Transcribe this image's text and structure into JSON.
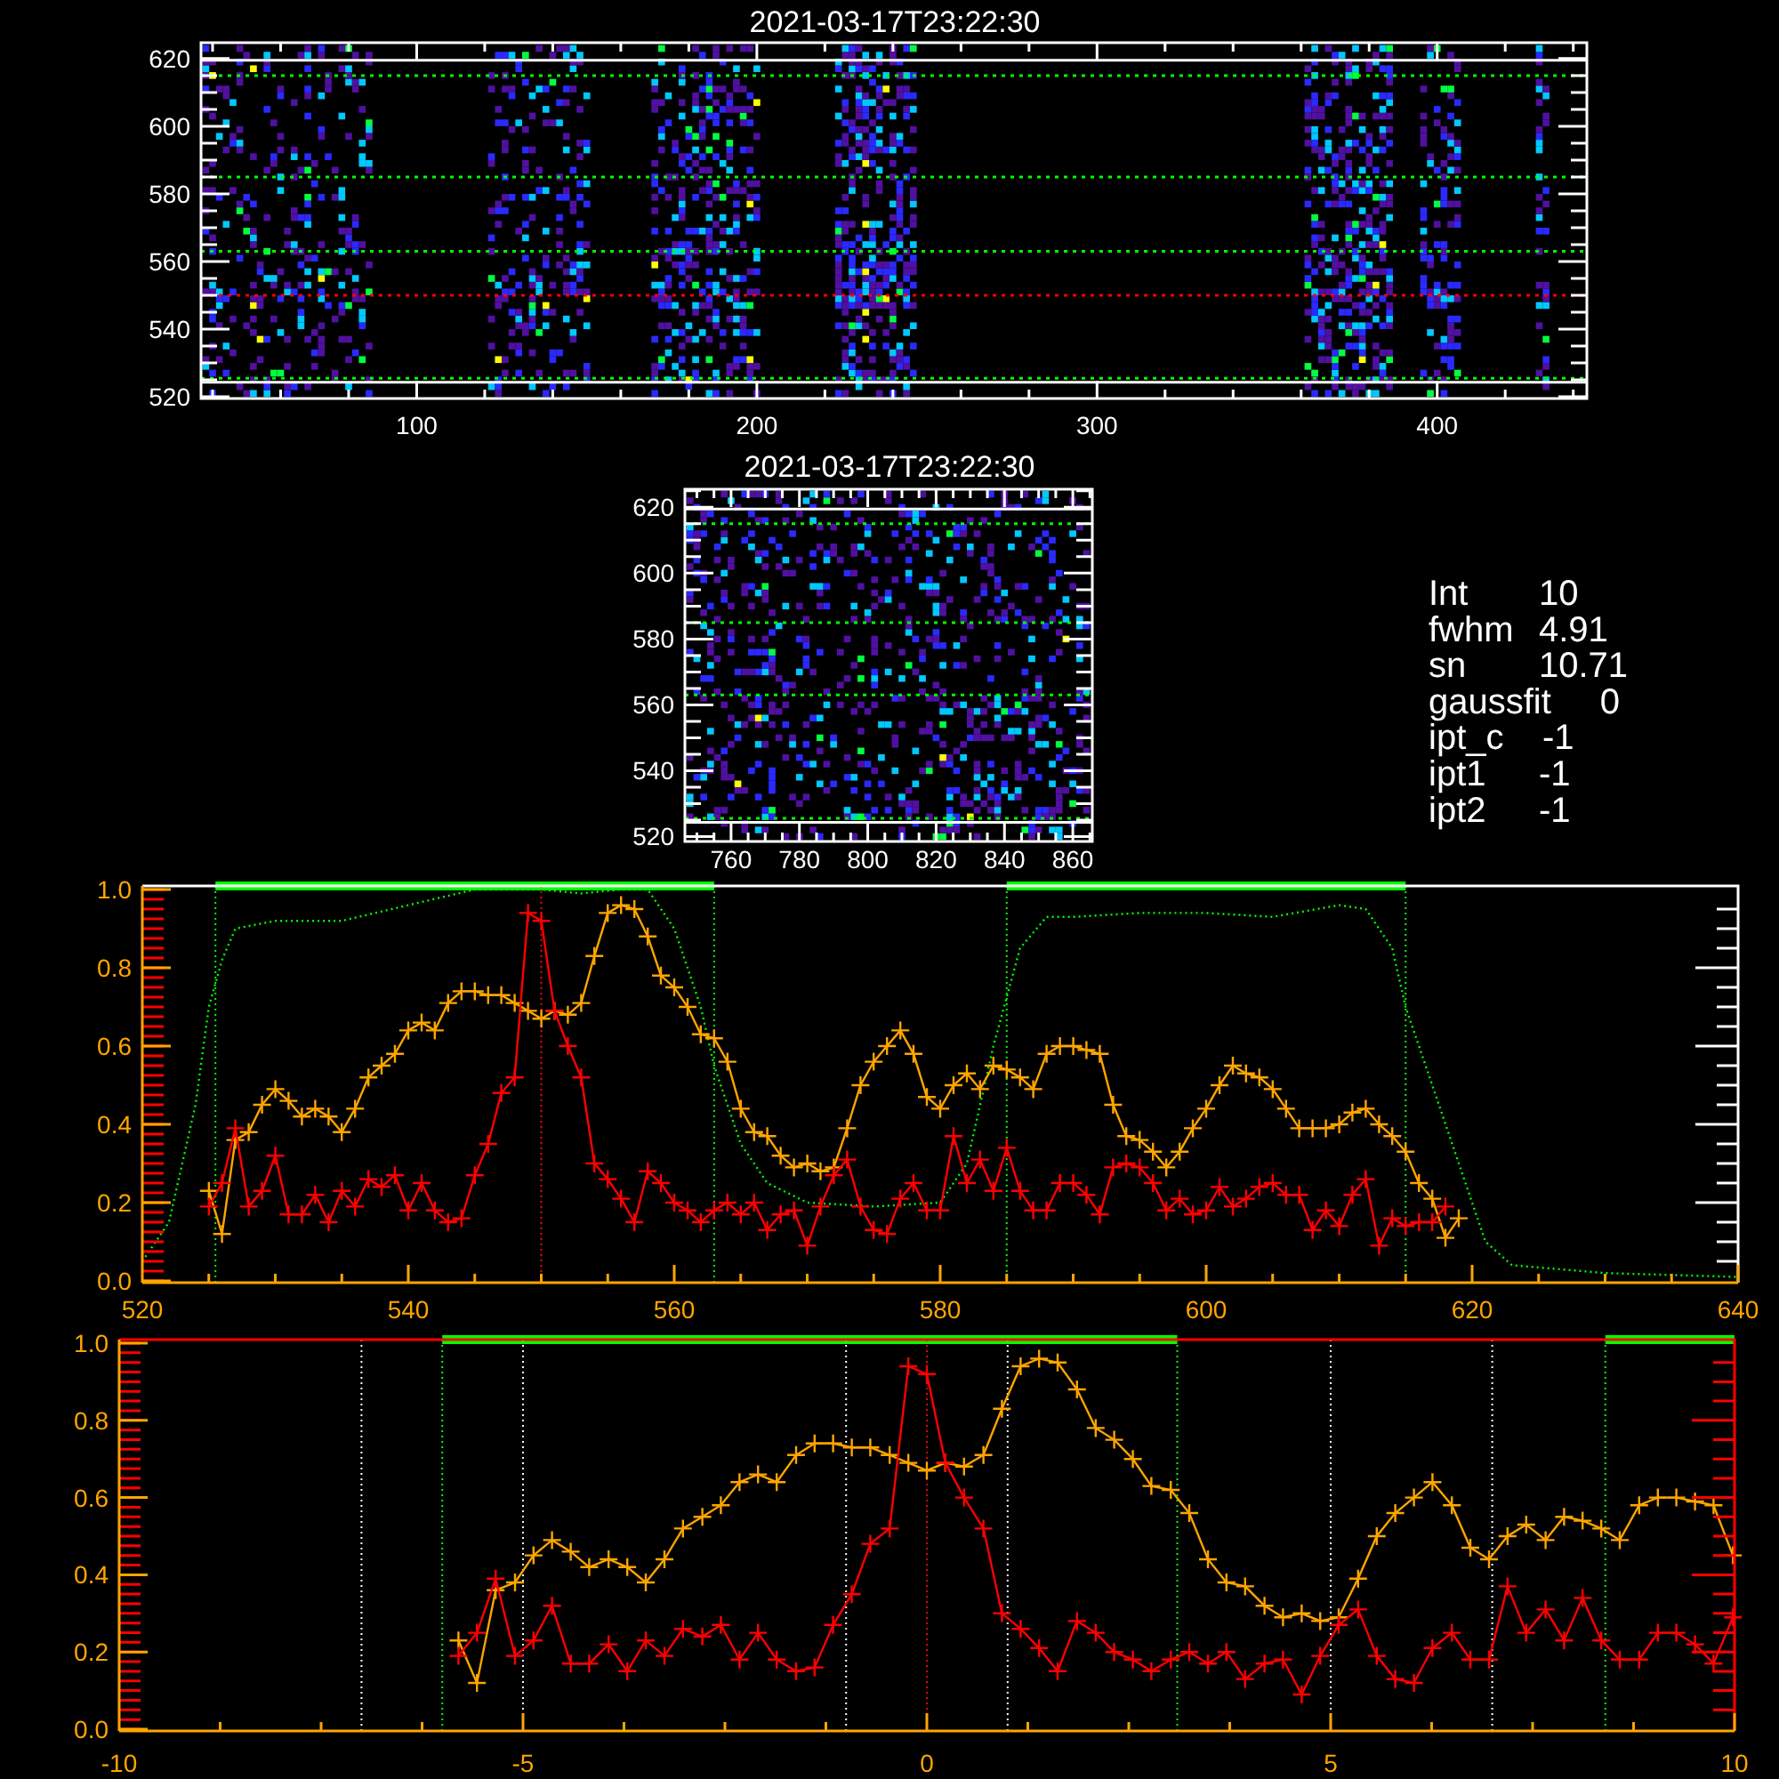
{
  "heatmaps": [
    {
      "title": "2021-03-17T23:22:30",
      "x_labels": [
        "100",
        "200",
        "300",
        "400"
      ],
      "y_labels": [
        "620",
        "600",
        "580",
        "560",
        "540",
        "520"
      ]
    },
    {
      "title": "2021-03-17T23:22:30",
      "x_labels": [
        "760",
        "780",
        "800",
        "820",
        "840",
        "860"
      ],
      "y_labels": [
        "620",
        "600",
        "580",
        "560",
        "540",
        "520"
      ]
    }
  ],
  "stats": [
    {
      "label": "Int",
      "value": "10"
    },
    {
      "label": "fwhm",
      "value": "4.91"
    },
    {
      "label": "sn",
      "value": "10.71"
    },
    {
      "label": "gaussfit",
      "value": "0"
    },
    {
      "label": "ipt_c",
      "value": "-1"
    },
    {
      "label": "ipt1",
      "value": "-1"
    },
    {
      "label": "ipt2",
      "value": "-1"
    }
  ],
  "charts": [
    {
      "chart_data": {
        "type": "line",
        "xlim": [
          520,
          640
        ],
        "ylim": [
          0,
          1
        ],
        "xticks": [
          520,
          540,
          560,
          580,
          600,
          620,
          640
        ],
        "yticks": [
          {
            "value": 0,
            "label": "0.0"
          },
          {
            "value": 0.2,
            "label": "0.2"
          },
          {
            "value": 0.4,
            "label": "0.4"
          },
          {
            "value": 0.6,
            "label": "0.6"
          },
          {
            "value": 0.8,
            "label": "0.8"
          },
          {
            "value": 1,
            "label": "1.0"
          }
        ],
        "x": [
          525,
          526,
          527,
          528,
          529,
          530,
          531,
          532,
          533,
          534,
          535,
          536,
          537,
          538,
          539,
          540,
          541,
          542,
          543,
          544,
          545,
          546,
          547,
          548,
          549,
          550,
          551,
          552,
          553,
          554,
          555,
          556,
          557,
          558,
          559,
          560,
          561,
          562,
          563,
          564,
          565,
          566,
          567,
          568,
          569,
          570,
          571,
          572,
          573,
          574,
          575,
          576,
          577,
          578,
          579,
          580,
          581,
          582,
          583,
          584,
          585,
          586,
          587,
          588,
          589,
          590,
          591,
          592,
          593,
          594,
          595,
          596,
          597,
          598,
          599,
          600,
          601,
          602,
          603,
          604,
          605,
          606,
          607,
          608,
          609,
          610,
          611,
          612,
          613,
          614,
          615,
          616,
          617,
          618,
          619
        ],
        "series": [
          {
            "color": "#00ff00",
            "line_style": "dotted",
            "x": [
              520,
              522,
              524,
              525,
              526,
              527,
              530,
              535,
              540,
              545,
              548,
              550,
              553,
              556,
              558,
              560,
              562,
              563,
              565,
              567,
              570,
              575,
              580,
              582,
              584,
              586,
              588,
              590,
              595,
              600,
              605,
              610,
              612,
              614,
              615,
              617,
              619,
              621,
              623,
              630,
              640
            ],
            "values": [
              0.05,
              0.15,
              0.45,
              0.7,
              0.82,
              0.9,
              0.92,
              0.92,
              0.96,
              1.0,
              1.0,
              1.0,
              0.99,
              1.0,
              1.0,
              0.9,
              0.7,
              0.55,
              0.35,
              0.25,
              0.2,
              0.19,
              0.2,
              0.3,
              0.6,
              0.85,
              0.93,
              0.93,
              0.94,
              0.94,
              0.93,
              0.96,
              0.95,
              0.85,
              0.7,
              0.5,
              0.3,
              0.1,
              0.04,
              0.02,
              0.01
            ]
          },
          {
            "color": "#ffa500",
            "marker": "+",
            "values": [
              0.23,
              0.12,
              0.36,
              0.38,
              0.45,
              0.49,
              0.46,
              0.42,
              0.44,
              0.42,
              0.38,
              0.44,
              0.52,
              0.55,
              0.58,
              0.64,
              0.66,
              0.64,
              0.71,
              0.74,
              0.74,
              0.73,
              0.73,
              0.71,
              0.69,
              0.67,
              0.69,
              0.68,
              0.71,
              0.83,
              0.94,
              0.96,
              0.95,
              0.88,
              0.78,
              0.75,
              0.7,
              0.63,
              0.62,
              0.56,
              0.44,
              0.38,
              0.37,
              0.32,
              0.29,
              0.3,
              0.28,
              0.29,
              0.39,
              0.5,
              0.56,
              0.6,
              0.64,
              0.58,
              0.47,
              0.44,
              0.5,
              0.53,
              0.49,
              0.55,
              0.54,
              0.52,
              0.49,
              0.58,
              0.6,
              0.6,
              0.59,
              0.58,
              0.45,
              0.37,
              0.36,
              0.33,
              0.29,
              0.33,
              0.39,
              0.44,
              0.5,
              0.55,
              0.53,
              0.52,
              0.49,
              0.44,
              0.39,
              0.39,
              0.39,
              0.4,
              0.43,
              0.44,
              0.4,
              0.37,
              0.33,
              0.25,
              0.21,
              0.11,
              0.16
            ]
          },
          {
            "color": "#ff0000",
            "marker": "+",
            "values": [
              0.19,
              0.25,
              0.39,
              0.19,
              0.23,
              0.32,
              0.17,
              0.17,
              0.22,
              0.15,
              0.23,
              0.19,
              0.26,
              0.24,
              0.27,
              0.18,
              0.25,
              0.18,
              0.15,
              0.16,
              0.27,
              0.35,
              0.48,
              0.52,
              0.94,
              0.92,
              0.69,
              0.6,
              0.52,
              0.3,
              0.26,
              0.21,
              0.15,
              0.28,
              0.25,
              0.2,
              0.18,
              0.15,
              0.18,
              0.2,
              0.17,
              0.2,
              0.13,
              0.17,
              0.18,
              0.09,
              0.19,
              0.27,
              0.31,
              0.19,
              0.13,
              0.12,
              0.21,
              0.25,
              0.18,
              0.18,
              0.37,
              0.25,
              0.31,
              0.23,
              0.34,
              0.23,
              0.18,
              0.18,
              0.25,
              0.25,
              0.22,
              0.17,
              0.29,
              0.3,
              0.29,
              0.25,
              0.18,
              0.21,
              0.17,
              0.18,
              0.24,
              0.19,
              0.21,
              0.24,
              0.25,
              0.22,
              0.22,
              0.13,
              0.18,
              0.14,
              0.22,
              0.26,
              0.09,
              0.16,
              0.14,
              0.15,
              0.15,
              0.19,
              null
            ]
          }
        ],
        "ref_lines": [
          {
            "axis": "x",
            "value": 525.5,
            "color": "#00ff00"
          },
          {
            "axis": "x",
            "value": 550,
            "color": "#ff0000"
          },
          {
            "axis": "x",
            "value": 563,
            "color": "#00ff00"
          },
          {
            "axis": "x",
            "value": 585,
            "color": "#00ff00"
          },
          {
            "axis": "x",
            "value": 615,
            "color": "#00ff00"
          }
        ]
      }
    },
    {
      "chart_data": {
        "type": "line",
        "xlim": [
          -10,
          10
        ],
        "ylim": [
          0,
          1
        ],
        "xticks": [
          -10,
          -5,
          0,
          5,
          10
        ],
        "yticks": [
          {
            "value": 0,
            "label": "0.0"
          },
          {
            "value": 0.2,
            "label": "0.2"
          },
          {
            "value": 0.4,
            "label": "0.4"
          },
          {
            "value": 0.6,
            "label": "0.6"
          },
          {
            "value": 0.8,
            "label": "0.8"
          },
          {
            "value": 1,
            "label": "1.0"
          }
        ],
        "x": [
          -5.8,
          -5.57,
          -5.34,
          -5.1,
          -4.87,
          -4.64,
          -4.41,
          -4.18,
          -3.94,
          -3.71,
          -3.48,
          -3.25,
          -3.02,
          -2.78,
          -2.55,
          -2.32,
          -2.09,
          -1.86,
          -1.62,
          -1.39,
          -1.16,
          -0.93,
          -0.7,
          -0.46,
          -0.23,
          0,
          0.23,
          0.46,
          0.7,
          0.93,
          1.16,
          1.39,
          1.62,
          1.86,
          2.09,
          2.32,
          2.55,
          2.78,
          3.02,
          3.25,
          3.48,
          3.71,
          3.94,
          4.18,
          4.41,
          4.64,
          4.87,
          5.1,
          5.34,
          5.57,
          5.8,
          6.03,
          6.26,
          6.5,
          6.73,
          6.96,
          7.19,
          7.42,
          7.66,
          7.89,
          8.12,
          8.35,
          8.58,
          8.82,
          9.05,
          9.28,
          9.51,
          9.74,
          9.98
        ],
        "series": [
          {
            "color": "#ffa500",
            "marker": "+",
            "values": [
              0.23,
              0.12,
              0.36,
              0.38,
              0.45,
              0.49,
              0.46,
              0.42,
              0.44,
              0.42,
              0.38,
              0.44,
              0.52,
              0.55,
              0.58,
              0.64,
              0.66,
              0.64,
              0.71,
              0.74,
              0.74,
              0.73,
              0.73,
              0.71,
              0.69,
              0.67,
              0.69,
              0.68,
              0.71,
              0.83,
              0.94,
              0.96,
              0.95,
              0.88,
              0.78,
              0.75,
              0.7,
              0.63,
              0.62,
              0.56,
              0.44,
              0.38,
              0.37,
              0.32,
              0.29,
              0.3,
              0.28,
              0.29,
              0.39,
              0.5,
              0.56,
              0.6,
              0.64,
              0.58,
              0.47,
              0.44,
              0.5,
              0.53,
              0.49,
              0.55,
              0.54,
              0.52,
              0.49,
              0.58,
              0.6,
              0.6,
              0.59,
              0.58,
              0.45
            ]
          },
          {
            "color": "#ff0000",
            "marker": "+",
            "values": [
              0.19,
              0.25,
              0.39,
              0.19,
              0.23,
              0.32,
              0.17,
              0.17,
              0.22,
              0.15,
              0.23,
              0.19,
              0.26,
              0.24,
              0.27,
              0.18,
              0.25,
              0.18,
              0.15,
              0.16,
              0.27,
              0.35,
              0.48,
              0.52,
              0.94,
              0.92,
              0.69,
              0.6,
              0.52,
              0.3,
              0.26,
              0.21,
              0.15,
              0.28,
              0.25,
              0.2,
              0.18,
              0.15,
              0.18,
              0.2,
              0.17,
              0.2,
              0.13,
              0.17,
              0.18,
              0.09,
              0.19,
              0.27,
              0.31,
              0.19,
              0.13,
              0.12,
              0.21,
              0.25,
              0.18,
              0.18,
              0.37,
              0.25,
              0.31,
              0.23,
              0.34,
              0.23,
              0.18,
              0.18,
              0.25,
              0.25,
              0.22,
              0.17,
              0.29
            ]
          }
        ],
        "ref_lines": [
          {
            "axis": "x",
            "value": -6,
            "color": "#00ff00"
          },
          {
            "axis": "x",
            "value": 3.1,
            "color": "#00ff00"
          },
          {
            "axis": "x",
            "value": 8.4,
            "color": "#00ff00"
          },
          {
            "axis": "x",
            "value": -7,
            "color": "#ffffff"
          },
          {
            "axis": "x",
            "value": -5,
            "color": "#ffffff"
          },
          {
            "axis": "x",
            "value": -1,
            "color": "#ffffff"
          },
          {
            "axis": "x",
            "value": 0,
            "color": "#ff0000"
          },
          {
            "axis": "x",
            "value": 1,
            "color": "#ffffff"
          },
          {
            "axis": "x",
            "value": 5,
            "color": "#ffffff"
          },
          {
            "axis": "x",
            "value": 7,
            "color": "#ffffff"
          }
        ]
      }
    }
  ]
}
